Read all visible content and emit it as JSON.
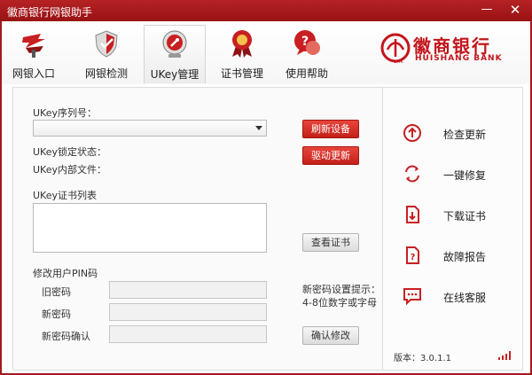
{
  "window": {
    "title": "徽商银行网银助手",
    "minimize": "—",
    "close": "✕"
  },
  "toolbar": {
    "items": [
      {
        "label": "网银入口",
        "icon": "bank-entry-arrow-icon"
      },
      {
        "label": "网银检测",
        "icon": "shield-check-icon"
      },
      {
        "label": "UKey管理",
        "icon": "ukey-disk-icon"
      },
      {
        "label": "证书管理",
        "icon": "certificate-medal-icon"
      },
      {
        "label": "使用帮助",
        "icon": "help-chat-icon"
      }
    ],
    "active_index": 2
  },
  "logo": {
    "cn": "徽商银行",
    "en": "HUISHANG BANK",
    "mark": "ank"
  },
  "ukey": {
    "serial_label": "UKey序列号：",
    "serial_value": "",
    "refresh_button": "刷新设备",
    "driver_button": "驱动更新",
    "lock_status_label": "UKey锁定状态：",
    "internal_files_label": "UKey内部文件：",
    "cert_list_label": "UKey证书列表",
    "view_cert_button": "查看证书"
  },
  "pin": {
    "section_label": "修改用户PIN码",
    "old_label": "旧密码",
    "new_label": "新密码",
    "confirm_label": "新密码确认",
    "hint_line1": "新密码设置提示：",
    "hint_line2": "4-8位数字或字母",
    "confirm_button": "确认修改"
  },
  "side": {
    "items": [
      {
        "label": "检查更新",
        "icon": "update-up-arrow-icon"
      },
      {
        "label": "一键修复",
        "icon": "repair-refresh-icon"
      },
      {
        "label": "下载证书",
        "icon": "download-document-icon"
      },
      {
        "label": "故障报告",
        "icon": "fault-report-icon"
      },
      {
        "label": "在线客服",
        "icon": "chat-bubble-icon"
      }
    ],
    "version": "版本：3.0.1.1"
  },
  "colors": {
    "brand": "#c3151c",
    "titlebar": "#a31a1c",
    "button_red": "#d9312a"
  }
}
